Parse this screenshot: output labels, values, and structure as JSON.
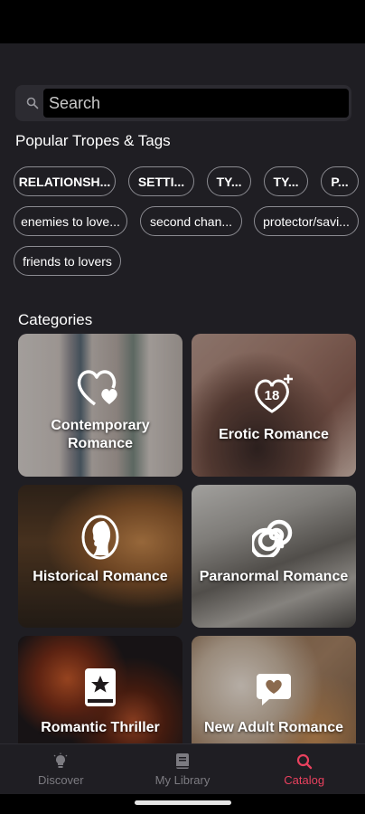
{
  "search": {
    "placeholder": "Search"
  },
  "tropes": {
    "title": "Popular Tropes & Tags",
    "tags": [
      "RELATIONSH...",
      "SETTI...",
      "TY...",
      "TY...",
      "P..."
    ],
    "tropes": [
      "enemies to love...",
      "second chan...",
      "protector/savi...",
      "friends to lovers"
    ]
  },
  "categories": {
    "title": "Categories",
    "items": [
      {
        "label": "Contemporary Romance",
        "icon": "hearts-icon"
      },
      {
        "label": "Erotic Romance",
        "icon": "heart-18-plus-icon"
      },
      {
        "label": "Historical Romance",
        "icon": "lady-silhouette-icon"
      },
      {
        "label": "Paranormal Romance",
        "icon": "spiral-icon"
      },
      {
        "label": "Romantic Thriller",
        "icon": "book-star-icon"
      },
      {
        "label": "New Adult Romance",
        "icon": "speech-heart-icon"
      }
    ]
  },
  "nav": {
    "items": [
      {
        "label": "Discover",
        "icon": "lightbulb-icon"
      },
      {
        "label": "My Library",
        "icon": "book-icon"
      },
      {
        "label": "Catalog",
        "icon": "search-icon"
      }
    ],
    "active": "Catalog"
  },
  "colors": {
    "accent": "#e8415e",
    "background": "#1f1e23",
    "muted": "#7c7b81"
  }
}
